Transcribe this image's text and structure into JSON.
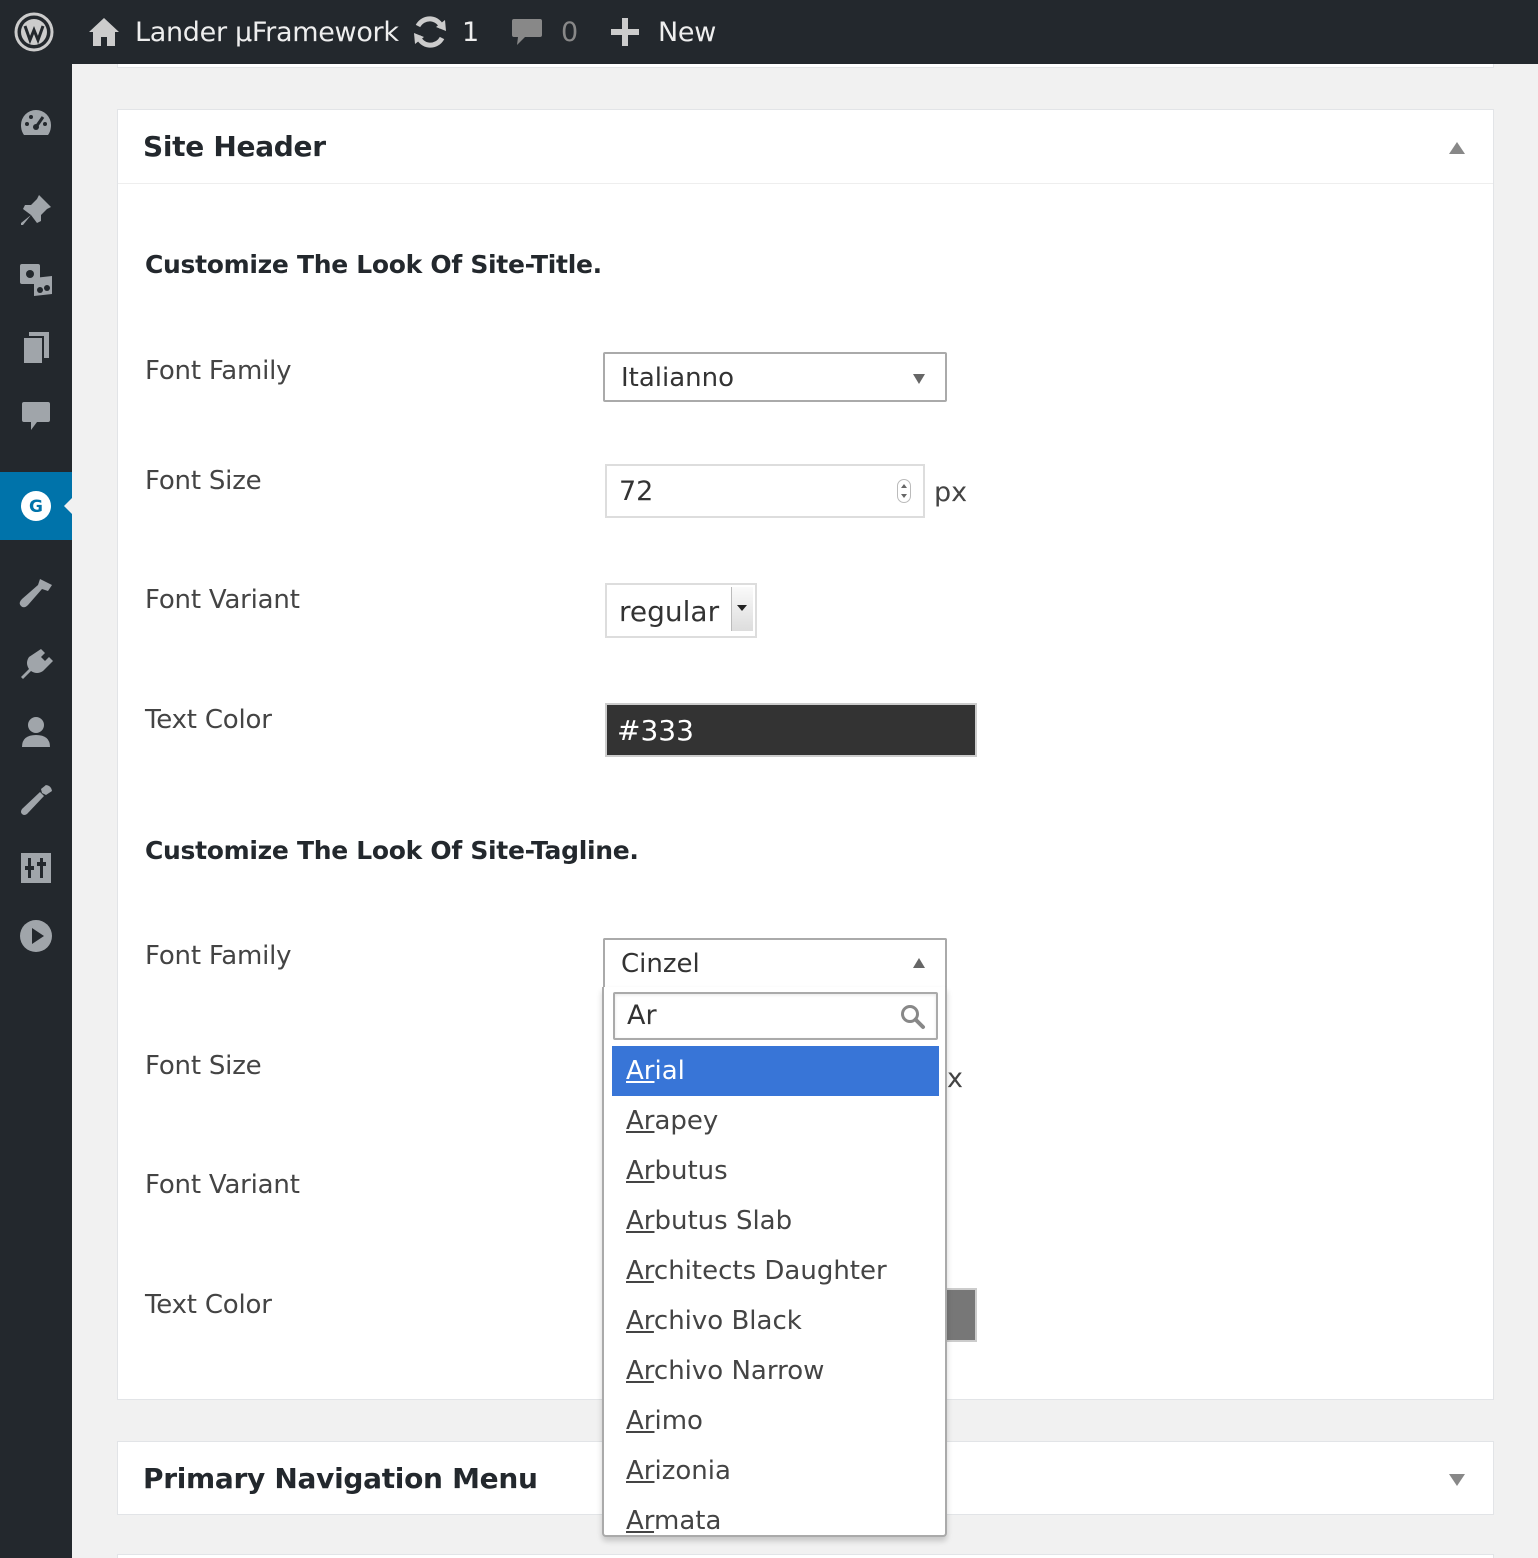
{
  "adminbar": {
    "site_name": "Lander µFramework",
    "updates_count": "1",
    "comments_count": "0",
    "new_label": "New",
    "icons": [
      "wordpress-logo-icon",
      "home-icon",
      "updates-icon",
      "comments-icon",
      "plus-icon"
    ]
  },
  "sidebar": {
    "items": [
      {
        "icon": "dashboard-icon"
      },
      {
        "icon": "pin-icon"
      },
      {
        "icon": "media-icon"
      },
      {
        "icon": "pages-icon"
      },
      {
        "icon": "comments-icon"
      },
      {
        "icon": "g-icon",
        "label": "G",
        "current": true
      },
      {
        "icon": "appearance-icon"
      },
      {
        "icon": "plugins-icon"
      },
      {
        "icon": "users-icon"
      },
      {
        "icon": "tools-icon"
      },
      {
        "icon": "settings-icon"
      },
      {
        "icon": "play-icon"
      }
    ]
  },
  "site_header_panel": {
    "title": "Site Header",
    "title_section": {
      "heading": "Customize The Look Of Site-Title.",
      "font_family_label": "Font Family",
      "font_family_value": "Italianno",
      "font_size_label": "Font Size",
      "font_size_value": "72",
      "font_size_unit": "px",
      "font_variant_label": "Font Variant",
      "font_variant_value": "regular",
      "text_color_label": "Text Color",
      "text_color_value": "#333"
    },
    "tagline_section": {
      "heading": "Customize The Look Of Site-Tagline.",
      "font_family_label": "Font Family",
      "font_family_value": "Cinzel",
      "font_size_label": "Font Size",
      "font_size_unit_partial": "x",
      "font_variant_label": "Font Variant",
      "text_color_label": "Text Color"
    }
  },
  "dropdown": {
    "search_value": "Ar",
    "highlighted_index": 0,
    "options": [
      {
        "match": "Ar",
        "rest": "ial"
      },
      {
        "match": "Ar",
        "rest": "apey"
      },
      {
        "match": "Ar",
        "rest": "butus"
      },
      {
        "match": "Ar",
        "rest": "butus Slab"
      },
      {
        "match": "Ar",
        "rest": "chitects Daughter"
      },
      {
        "match": "Ar",
        "rest": "chivo Black"
      },
      {
        "match": "Ar",
        "rest": "chivo Narrow"
      },
      {
        "match": "Ar",
        "rest": "imo"
      },
      {
        "match": "Ar",
        "rest": "izonia"
      },
      {
        "match": "Ar",
        "rest": "mata"
      }
    ]
  },
  "nav_panel": {
    "title": "Primary Navigation Menu"
  },
  "colors": {
    "adminbar_bg": "#23282d",
    "accent": "#0073aa",
    "highlight": "#3875d7",
    "title_text_color": "#333333",
    "tagline_text_color": "#777777"
  }
}
